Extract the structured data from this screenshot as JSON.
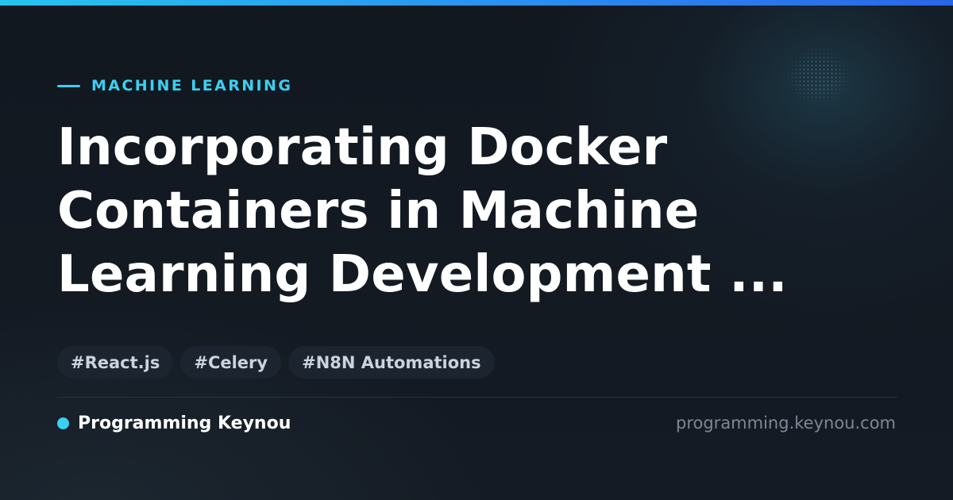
{
  "category": {
    "label": "MACHINE LEARNING",
    "accent_color": "#3ad0f2"
  },
  "title": "Incorporating Docker Containers in Machine Learning Development ...",
  "tags": [
    {
      "label": "#React.js"
    },
    {
      "label": "#Celery"
    },
    {
      "label": "#N8N Automations"
    }
  ],
  "footer": {
    "brand_name": "Programming Keynou",
    "url": "programming.keynou.com"
  },
  "colors": {
    "background": "#121820",
    "accent": "#3ad0f2",
    "top_bar_start": "#27c4ef",
    "top_bar_end": "#2a66e8",
    "tag_background": "#1c242f",
    "muted_text": "#7d8794"
  }
}
